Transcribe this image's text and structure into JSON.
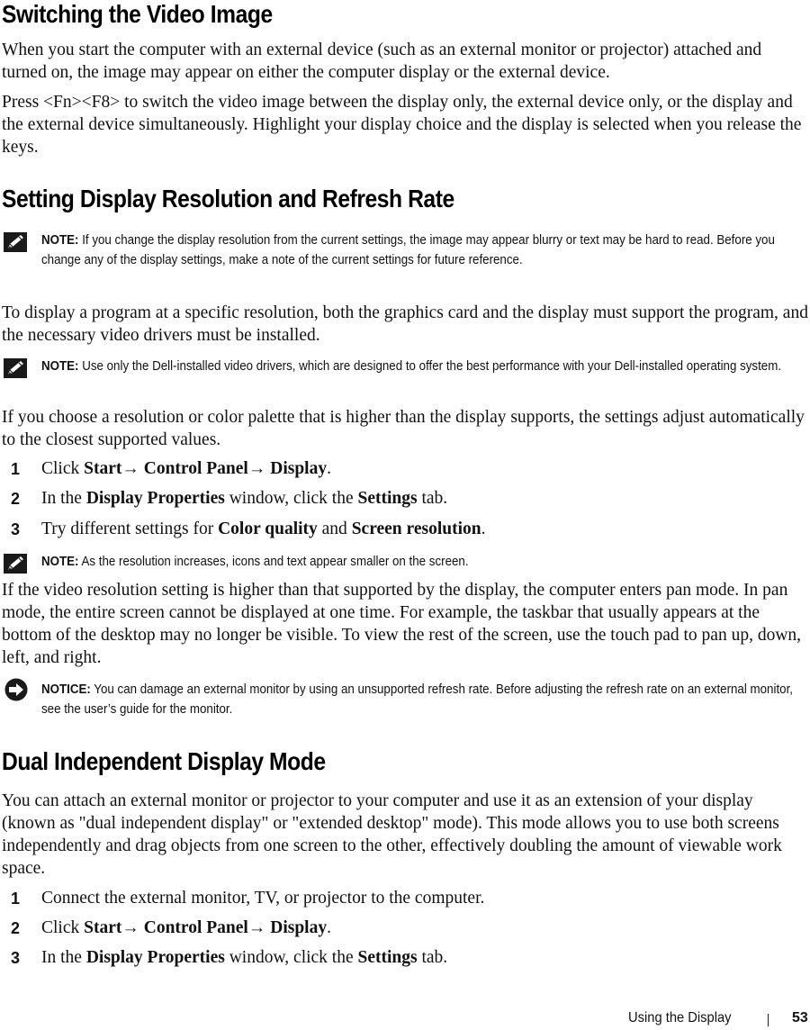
{
  "sections": {
    "video": {
      "title": "Switching the Video Image",
      "p1": "When you start the computer with an external device (such as an external monitor or projector) attached and turned on, the image may appear on either the computer display or the external device.",
      "p2": "Press <Fn><F8> to switch the video image between the display only, the external device only, or the display and the external device simultaneously. Highlight your display choice and the display is selected when you release the keys."
    },
    "resolution": {
      "title": "Setting Display Resolution and Refresh Rate",
      "note1": {
        "label": "NOTE:",
        "text": " If you change the display resolution from the current settings, the image may appear blurry or text may be hard to read. Before you change any of the display settings, make a note of the current settings for future reference.",
        "icon": "pencil-note-icon"
      },
      "p1": "To display a program at a specific resolution, both the graphics card and the display must support the program, and the necessary video drivers must be installed.",
      "note2": {
        "label": "NOTE:",
        "text": " Use only the Dell-installed video drivers, which are designed to offer the best performance with your Dell-installed operating system.",
        "icon": "pencil-note-icon"
      },
      "p2": "If you choose a resolution or color palette that is higher than the display supports, the settings adjust automatically to the closest supported values.",
      "steps": [
        {
          "num": "1",
          "parts": [
            {
              "t": "Click ",
              "b": false
            },
            {
              "t": "Start",
              "b": true
            },
            {
              "t": "→ ",
              "b": false
            },
            {
              "t": "Control Panel",
              "b": true
            },
            {
              "t": "→ ",
              "b": false
            },
            {
              "t": "Display",
              "b": true
            },
            {
              "t": ".",
              "b": false
            }
          ]
        },
        {
          "num": "2",
          "parts": [
            {
              "t": "In the ",
              "b": false
            },
            {
              "t": "Display Properties",
              "b": true
            },
            {
              "t": " window, click the ",
              "b": false
            },
            {
              "t": "Settings",
              "b": true
            },
            {
              "t": " tab.",
              "b": false
            }
          ]
        },
        {
          "num": "3",
          "parts": [
            {
              "t": "Try different settings for ",
              "b": false
            },
            {
              "t": "Color quality",
              "b": true
            },
            {
              "t": " and ",
              "b": false
            },
            {
              "t": "Screen resolution",
              "b": true
            },
            {
              "t": ".",
              "b": false
            }
          ]
        }
      ],
      "note3": {
        "label": "NOTE:",
        "text": " As the resolution increases, icons and text appear smaller on the screen.",
        "icon": "pencil-note-icon"
      },
      "p3": "If the video resolution setting is higher than that supported by the display, the computer enters pan mode. In pan mode, the entire screen cannot be displayed at one time. For example, the taskbar that usually appears at the bottom of the desktop may no longer be visible. To view the rest of the screen, use the touch pad to pan up, down, left, and right.",
      "notice": {
        "label": "NOTICE:",
        "text": " You can damage an external monitor by using an unsupported refresh rate. Before adjusting the refresh rate on an external monitor, see the user’s guide for the monitor.",
        "icon": "notice-arrow-icon"
      }
    },
    "dual": {
      "title": "Dual Independent Display Mode",
      "p1": "You can attach an external monitor or projector to your computer and use it as an extension of your display (known as \"dual independent display\" or \"extended desktop\" mode). This mode allows you to use both screens independently and drag objects from one screen to the other, effectively doubling the amount of viewable work space.",
      "steps": [
        {
          "num": "1",
          "parts": [
            {
              "t": "Connect the external monitor, TV, or projector to the computer.",
              "b": false
            }
          ]
        },
        {
          "num": "2",
          "parts": [
            {
              "t": "Click ",
              "b": false
            },
            {
              "t": "Start",
              "b": true
            },
            {
              "t": "→ ",
              "b": false
            },
            {
              "t": "Control Panel",
              "b": true
            },
            {
              "t": "→ ",
              "b": false
            },
            {
              "t": "Display",
              "b": true
            },
            {
              "t": ".",
              "b": false
            }
          ]
        },
        {
          "num": "3",
          "parts": [
            {
              "t": "In the ",
              "b": false
            },
            {
              "t": "Display Properties",
              "b": true
            },
            {
              "t": " window, click the ",
              "b": false
            },
            {
              "t": "Settings",
              "b": true
            },
            {
              "t": " tab.",
              "b": false
            }
          ]
        }
      ]
    }
  },
  "footer": {
    "section": "Using the Display",
    "page": "53"
  }
}
